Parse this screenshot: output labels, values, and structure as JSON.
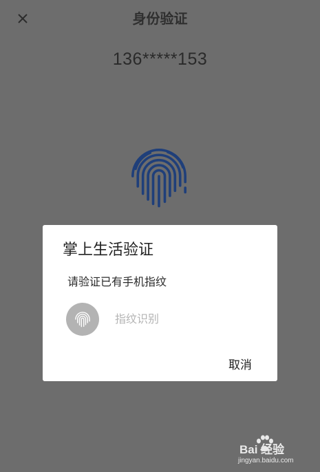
{
  "header": {
    "title": "身份验证",
    "close_icon": "close-icon"
  },
  "phone_masked": "136*****153",
  "background_icon": "fingerprint-icon",
  "dialog": {
    "title": "掌上生活验证",
    "message": "请验证已有手机指纹",
    "fingerprint_icon": "fingerprint-icon",
    "fingerprint_hint": "指纹识别",
    "cancel_label": "取消"
  },
  "watermark": {
    "brand": "Bai  经验",
    "url": "jingyan.baidu.com"
  },
  "colors": {
    "overlay_bg": "#6d6d6d",
    "fingerprint_blue": "#1f3f7a",
    "dialog_bg": "#ffffff",
    "hint_gray": "#b4b4b4"
  }
}
